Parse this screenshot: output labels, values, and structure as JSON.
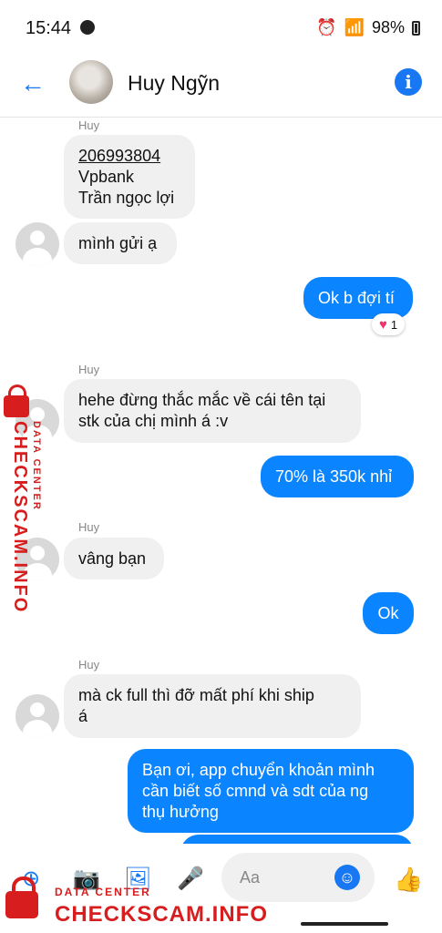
{
  "status": {
    "time": "15:44",
    "battery": "98%"
  },
  "header": {
    "back_icon": "arrow-left-icon",
    "name": "Huy Ngỹn",
    "info_icon": "info-icon"
  },
  "messages": {
    "sender": "Huy",
    "m1_line1": "206993804",
    "m1_line2": "Vpbank",
    "m1_line3": "Trần ngọc lợi",
    "m2": "mình gửi ạ",
    "m3": "Ok b đợi tí",
    "reaction": "1",
    "m4_line1": "hehe đừng thắc mắc về cái tên tại",
    "m4_line2": "stk của chị mình á :v",
    "m5": "70% là 350k nhỉ",
    "m6": "vâng bạn",
    "m7": "Ok",
    "m8_line1": "mà ck full thì đỡ mất phí khi ship",
    "m8_line2": "á",
    "m9_line1": "Bạn ơi, app chuyển khoản mình",
    "m9_line2": "cần biết số cmnd và sdt của ng",
    "m9_line3": "thụ hưởng"
  },
  "composer": {
    "placeholder": "Aa"
  },
  "watermark": {
    "small": "DATA CENTER",
    "big": "CHECKSCAM.INFO"
  },
  "colors": {
    "accent": "#1877f2",
    "outgoing": "#0a84ff",
    "incoming": "#f0f0f0",
    "watermark": "#d71d1d"
  }
}
